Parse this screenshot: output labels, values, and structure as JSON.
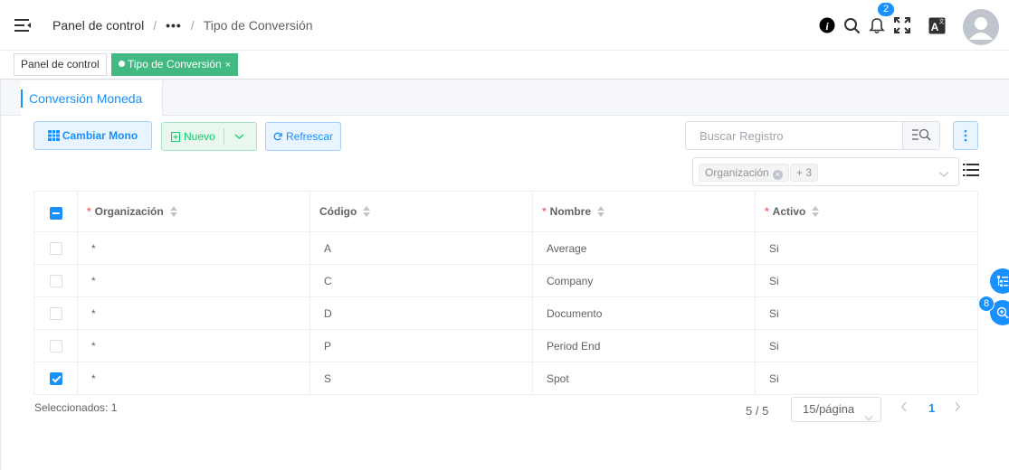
{
  "navbar": {
    "breadcrumb": [
      "Panel de control",
      "•••",
      "Tipo de Conversión"
    ],
    "notification_count": "2"
  },
  "tags": [
    {
      "label": "Panel de control",
      "active": false
    },
    {
      "label": "Tipo de Conversión",
      "active": true,
      "close": "×"
    }
  ],
  "tab": {
    "label": "Conversión Moneda"
  },
  "toolbar": {
    "cambiar_label": "Cambiar Mono",
    "nuevo_label": "Nuevo",
    "refrescar_label": "Refrescar"
  },
  "search": {
    "placeholder": "Buscar Registro"
  },
  "filter": {
    "chip": "Organización",
    "more": "+ 3"
  },
  "table": {
    "columns": [
      {
        "label": "Organización",
        "required": true
      },
      {
        "label": "Código",
        "required": false
      },
      {
        "label": "Nombre",
        "required": true
      },
      {
        "label": "Activo",
        "required": true
      }
    ],
    "rows": [
      {
        "org": "*",
        "codigo": "A",
        "nombre": "Average",
        "activo": "Si",
        "checked": false
      },
      {
        "org": "*",
        "codigo": "C",
        "nombre": "Company",
        "activo": "Si",
        "checked": false
      },
      {
        "org": "*",
        "codigo": "D",
        "nombre": "Documento",
        "activo": "Si",
        "checked": false
      },
      {
        "org": "*",
        "codigo": "P",
        "nombre": "Period End",
        "activo": "Si",
        "checked": false
      },
      {
        "org": "*",
        "codigo": "S",
        "nombre": "Spot",
        "activo": "Si",
        "checked": true
      }
    ]
  },
  "footer": {
    "selected": "Seleccionados: 1",
    "total": "5 / 5",
    "page_size": "15/página",
    "current_page": "1"
  },
  "float": {
    "badge": "8"
  },
  "colors": {
    "primary": "#1890ff",
    "success": "#13ce66",
    "tag_active": "#42b983",
    "required": "#f56c6c"
  }
}
